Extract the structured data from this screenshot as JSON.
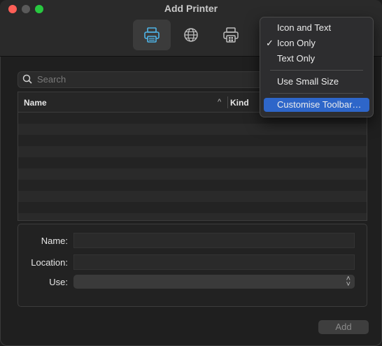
{
  "window": {
    "title": "Add Printer"
  },
  "toolbar": {
    "items": [
      {
        "icon": "printer-icon",
        "active": true
      },
      {
        "icon": "globe-icon",
        "active": false
      },
      {
        "icon": "windows-printer-icon",
        "active": false
      }
    ]
  },
  "search": {
    "placeholder": "Search"
  },
  "table": {
    "columns": [
      "Name",
      "Kind"
    ],
    "sort_indicator": "^",
    "rows": []
  },
  "form": {
    "name_label": "Name:",
    "location_label": "Location:",
    "use_label": "Use:",
    "name_value": "",
    "location_value": "",
    "use_value": ""
  },
  "add_label": "Add",
  "context_menu": {
    "check_mark": "✓",
    "items": [
      "Icon and Text",
      "Icon Only",
      "Text Only",
      "Use Small Size",
      "Customise Toolbar…"
    ],
    "checked": "Icon Only",
    "highlighted": "Customise Toolbar…"
  },
  "colors": {
    "accent": "#2e66c9",
    "close": "#ff5f57",
    "zoom": "#28c840"
  }
}
